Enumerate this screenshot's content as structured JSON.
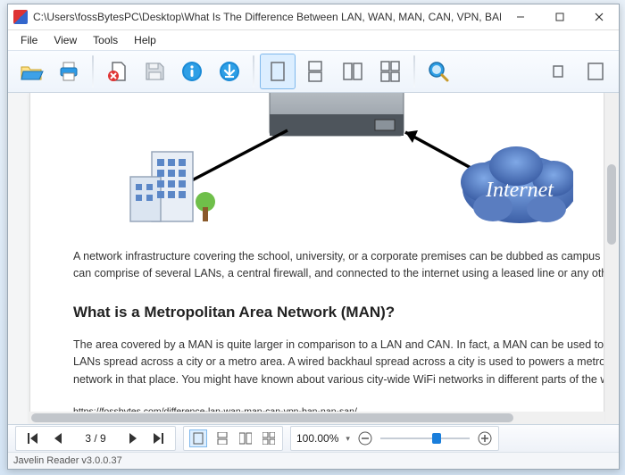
{
  "window": {
    "title": "C:\\Users\\fossBytesPC\\Desktop\\What Is The Difference Between LAN, WAN, MAN, CAN, VPN, BAN, NAN, SAN_.pdf",
    "minimize": "—",
    "maximize": "☐",
    "close": "✕"
  },
  "menubar": {
    "file": "File",
    "view": "View",
    "tools": "Tools",
    "help": "Help"
  },
  "toolbar": {
    "open": "open-icon",
    "print": "print-icon",
    "remove": "remove-file-icon",
    "save": "save-icon",
    "info": "info-icon",
    "download": "download-icon",
    "page_single": "single-page-icon",
    "page_continuous": "continuous-page-icon",
    "page_facing": "facing-page-icon",
    "page_facing_cont": "facing-continuous-icon",
    "zoom": "zoom-icon",
    "thumb_small": "thumb-small-icon",
    "thumb_large": "thumb-large-icon"
  },
  "doc": {
    "diagram_internet_label": "Internet",
    "para1": "A network infrastructure covering the school, university, or a corporate premises can be dubbed as campus area network. It can comprise of several LANs, a central firewall, and connected to the internet using a leased line or any other means.",
    "heading": "What is a Metropolitan Area Network (MAN)?",
    "para2": "The area covered by a MAN is quite larger in comparison to a LAN and CAN. In fact, a MAN can be used to link several LANs spread across a city or a metro area. A wired backhaul spread across a city is used to powers a metropolitan area network in that place. You might have known about various city-wide WiFi networks in different parts of the world.",
    "url": "https://fossbytes.com/difference-lan-wan-man-can-vpn-ban-nan-san/"
  },
  "nav": {
    "first": "first-page-icon",
    "prev": "prev-page-icon",
    "page_display": "3 / 9",
    "next": "next-page-icon",
    "last": "last-page-icon"
  },
  "zoom": {
    "label": "100.00%",
    "dropdown": "▾",
    "minus": "−",
    "plus": "+"
  },
  "status": {
    "text": "Javelin Reader v3.0.0.37"
  }
}
